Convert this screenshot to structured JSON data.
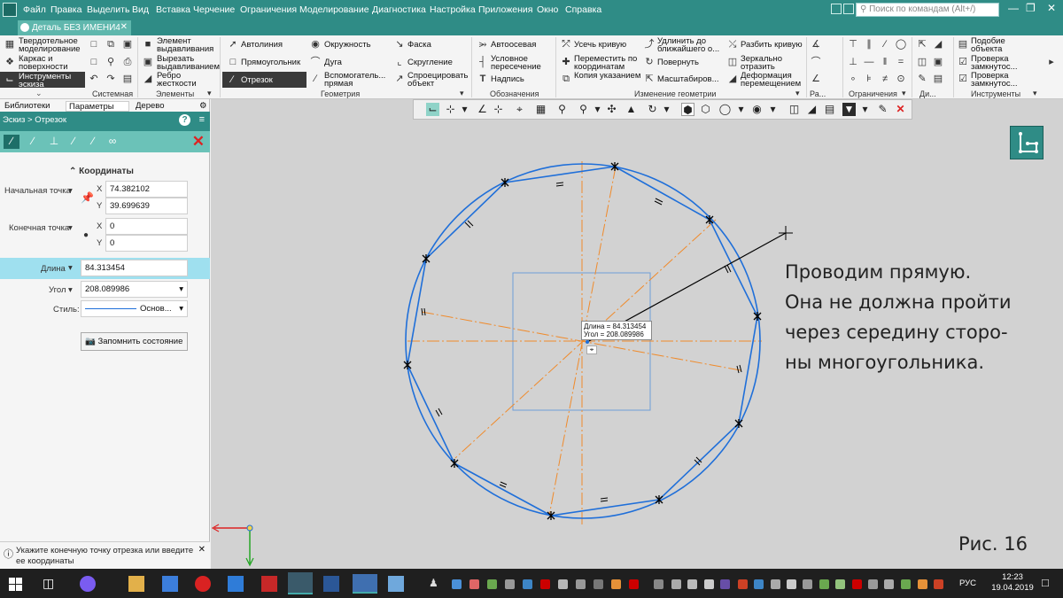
{
  "menu": {
    "items": [
      "Файл",
      "Правка",
      "Выделить",
      "Вид",
      "Вставка",
      "Черчение",
      "Ограничения",
      "Моделирование",
      "Диагностика",
      "Настройка",
      "Приложения",
      "Окно",
      "Справка"
    ],
    "search_placeholder": "Поиск по командам (Alt+/)"
  },
  "document": {
    "tab_label": "Деталь БЕЗ ИМЕНИ4"
  },
  "ribbon": {
    "system": {
      "items": [
        "Твердотельное моделирование",
        "Каркас и поверхности",
        "Инструменты эскиза"
      ],
      "label": "Системная"
    },
    "elements": {
      "items": [
        "Элемент выдавливания",
        "Вырезать выдавливанием",
        "Ребро жесткости"
      ],
      "label": "Элементы"
    },
    "geometry": {
      "items": [
        "Автолиния",
        "Окружность",
        "Фаска",
        "Прямоугольник",
        "Дуга",
        "Скругление",
        "Отрезок",
        "Вспомогатель... прямая",
        "Спроецировать объект"
      ],
      "label": "Геометрия"
    },
    "annotations": {
      "items": [
        "Автоосевая",
        "Условное пересечение",
        "Надпись"
      ],
      "label": "Обозначения"
    },
    "edit": {
      "items": [
        "Усечь кривую",
        "Удлинить до ближайшего о...",
        "Разбить кривую",
        "Переместить по координатам",
        "Повернуть",
        "Зеркально отразить",
        "Копия указанием",
        "Масштабиров...",
        "Деформация перемещением"
      ],
      "label": "Изменение геометрии"
    },
    "misc_labels": [
      "Ра...",
      "Ограничения",
      "Ди...",
      "Инструменты"
    ],
    "tools": {
      "items": [
        "Подобие объекта",
        "Проверка замкнутос...",
        "Проверка замкнутос..."
      ]
    }
  },
  "panel": {
    "tabs": [
      "Библиотеки",
      "Параметры",
      "Дерево"
    ],
    "breadcrumb": "Эскиз > Отрезок",
    "section_title": "Координаты",
    "start_label": "Начальная точка",
    "end_label": "Конечная точка",
    "x_letter": "X",
    "y_letter": "Y",
    "start_x": "74.382102",
    "start_y": "39.699639",
    "end_x": "0",
    "end_y": "0",
    "length_label": "Длина",
    "length_value": "84.313454",
    "angle_label": "Угол",
    "angle_value": "208.089986",
    "style_label": "Стиль:",
    "style_value": "Основ...",
    "save_state_button": "Запомнить состояние"
  },
  "status": {
    "message": "Укажите конечную точку отрезка или введите ее координаты"
  },
  "canvas": {
    "tooltip_length": "Длина = 84.313454",
    "tooltip_angle": "Угол = 208.089986",
    "annotation_lines": [
      "Проводим прямую.",
      "Она не должна пройти",
      "через середину сторо-",
      "ны многоугольника."
    ],
    "figure_label": "Рис. 16"
  },
  "taskbar": {
    "language": "РУС",
    "time": "12:23",
    "date": "19.04.2019"
  },
  "colors": {
    "accent": "#2f8c86",
    "sketch_blue": "#1f6fd9",
    "axis_orange": "#f08a2a"
  }
}
